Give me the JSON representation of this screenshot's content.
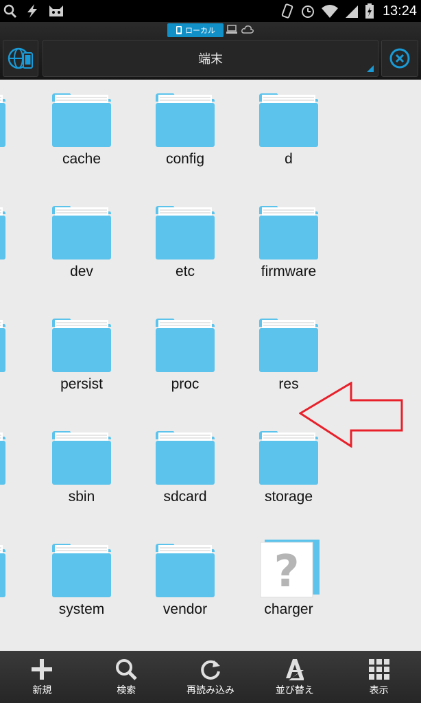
{
  "status_bar": {
    "time": "13:24",
    "left_icons": [
      "search-icon",
      "flash-icon",
      "cat-icon"
    ],
    "right_icons": [
      "vibrate-icon",
      "alarm-icon",
      "wifi-icon",
      "signal-icon",
      "battery-icon"
    ]
  },
  "tabs": {
    "local_label": "ローカル",
    "network_icons": [
      "computer-icon",
      "cloud-icon"
    ]
  },
  "location": {
    "label": "端末"
  },
  "folders": [
    [
      "cache",
      "config",
      "d"
    ],
    [
      "dev",
      "etc",
      "firmware"
    ],
    [
      "persist",
      "proc",
      "res"
    ],
    [
      "sbin",
      "sdcard",
      "storage"
    ],
    [
      "system",
      "vendor",
      "charger"
    ]
  ],
  "unknown_file": "charger",
  "toolbar": {
    "new_label": "新規",
    "search_label": "検索",
    "reload_label": "再読み込み",
    "sort_label": "並び替え",
    "view_label": "表示"
  },
  "colors": {
    "folder": "#5bc3ec",
    "accent": "#1190c8",
    "arrow": "#e8202a",
    "content_bg": "#ebebeb"
  }
}
